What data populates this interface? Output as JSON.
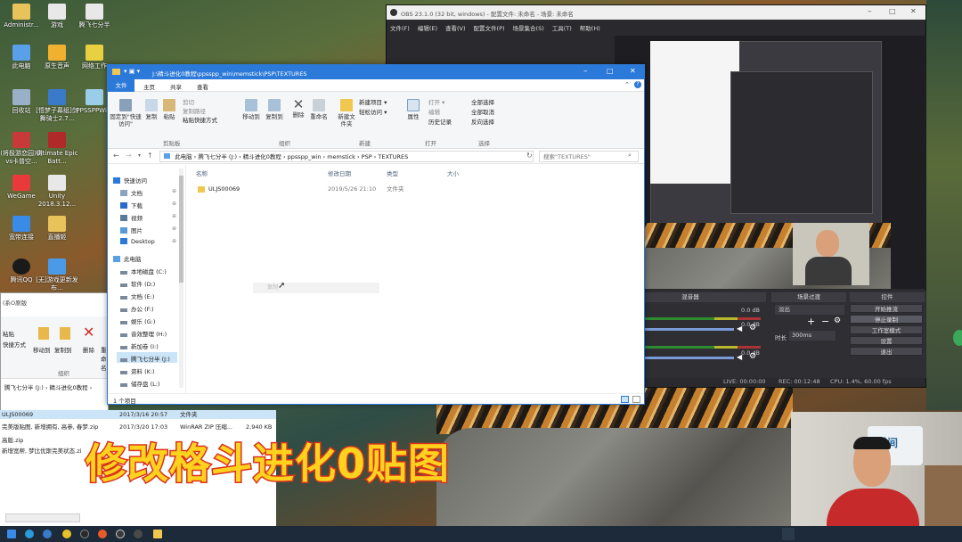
{
  "desktop": {
    "icons": [
      {
        "label": "Administr...",
        "color": "#e8c25a"
      },
      {
        "label": "游戏",
        "color": "#e8e8e8"
      },
      {
        "label": "腾飞七分半",
        "color": "#e8e8e8"
      },
      {
        "label": "此电脑",
        "color": "#5aa0e8"
      },
      {
        "label": "原生音声",
        "color": "#f0b030"
      },
      {
        "label": "网络工作",
        "color": "#e8d040"
      },
      {
        "label": "回收站",
        "color": "#9ab0c8"
      },
      {
        "label": "[悟梦子幕组]剑舞骑士2.7...",
        "color": "#3a7ac8"
      },
      {
        "label": "PPSSPPWi...",
        "color": "#9acde8"
      },
      {
        "label": "(将极游恋园)赛vs卡普空...",
        "color": "#c83a3a"
      },
      {
        "label": "Ultimate Epic Batt...",
        "color": "#b02a2a"
      },
      {
        "label": "WeGame",
        "color": "#e83a3a"
      },
      {
        "label": "Unity 2018.3.12...",
        "color": "#e8e8e8"
      },
      {
        "label": "宽带连接",
        "color": "#3a8ae8"
      },
      {
        "label": "直播姬",
        "color": "#e8c25a"
      },
      {
        "label": "腾讯QQ",
        "color": "#1a1a1a"
      },
      {
        "label": "[无]游戏更新发布…",
        "color": "#4a9ae8"
      }
    ]
  },
  "bg_explorer": {
    "title": "(系O原版",
    "ribbon": [
      "粘贴",
      "快捷方式",
      "移动到",
      "复制到",
      "删除",
      "重命名",
      "组织"
    ],
    "path": [
      "腾飞七分半 (J:)",
      "精斗进化0教程"
    ],
    "files": [
      {
        "name": "ULJS00069",
        "date": "2017/3/16 20:57",
        "type": "文件夹",
        "size": ""
      },
      {
        "name": "完美版贴图, 新增拥有, 高参, 春梦.zip",
        "date": "2017/3/20 17:03",
        "type": "WinRAR ZIP 压缩...",
        "size": "2,940 KB"
      },
      {
        "name": "高版.zip",
        "date": "",
        "type": "",
        "size": ""
      },
      {
        "name": "新增宽帮, 梦比优斯完美状态.zi",
        "date": "",
        "type": "",
        "size": ""
      }
    ]
  },
  "explorer": {
    "title": "J:\\精斗进化0教程\\ppsspp_win\\memstick\\PSP\\TEXTURES",
    "tabs": [
      "文件",
      "主页",
      "共享",
      "查看"
    ],
    "ribbon": {
      "clipboard": {
        "group": "剪贴板",
        "pin": "固定到\"快速访问\"",
        "copy": "复制",
        "paste": "粘贴",
        "cut": "剪切",
        "copy_path": "复制路径",
        "paste_shortcut": "粘贴快捷方式"
      },
      "organize": {
        "group": "组织",
        "move_to": "移动到",
        "copy_to": "复制到",
        "delete": "删除",
        "rename": "重命名"
      },
      "new": {
        "group": "新建",
        "new_folder": "新建文件夹",
        "new_item": "新建项目 ▾",
        "easy_access": "轻松访问 ▾"
      },
      "open": {
        "group": "打开",
        "properties": "属性",
        "open": "打开 ▾",
        "edit": "编辑",
        "history": "历史记录"
      },
      "select": {
        "group": "选择",
        "select_all": "全部选择",
        "select_none": "全部取消",
        "invert": "反向选择"
      }
    },
    "address": [
      "此电脑",
      "腾飞七分半 (J:)",
      "精斗进化0教程",
      "ppsspp_win",
      "memstick",
      "PSP",
      "TEXTURES"
    ],
    "search_placeholder": "搜索\"TEXTURES\"",
    "nav": [
      {
        "label": "快速访问",
        "pin": false,
        "kind": "star"
      },
      {
        "label": "文档",
        "pin": true,
        "kind": "doc"
      },
      {
        "label": "下载",
        "pin": true,
        "kind": "down"
      },
      {
        "label": "视频",
        "pin": true,
        "kind": "video"
      },
      {
        "label": "图片",
        "pin": true,
        "kind": "pic"
      },
      {
        "label": "Desktop",
        "pin": true,
        "kind": "desk"
      },
      {
        "label": "此电脑",
        "pin": false,
        "kind": "pc"
      },
      {
        "label": "本地磁盘 (C:)",
        "pin": false,
        "kind": "drive"
      },
      {
        "label": "软件 (D:)",
        "pin": false,
        "kind": "drive"
      },
      {
        "label": "文档 (E:)",
        "pin": false,
        "kind": "drive"
      },
      {
        "label": "办公 (F:)",
        "pin": false,
        "kind": "drive"
      },
      {
        "label": "娱乐 (G:)",
        "pin": false,
        "kind": "drive"
      },
      {
        "label": "音效整理 (H:)",
        "pin": false,
        "kind": "drive"
      },
      {
        "label": "新加卷 (I:)",
        "pin": false,
        "kind": "drive"
      },
      {
        "label": "腾飞七分半 (J:)",
        "pin": false,
        "kind": "drive"
      },
      {
        "label": "资料 (K:)",
        "pin": false,
        "kind": "drive"
      },
      {
        "label": "储存盘 (L:)",
        "pin": false,
        "kind": "drive"
      }
    ],
    "columns": [
      "名称",
      "修改日期",
      "类型",
      "大小"
    ],
    "files": [
      {
        "name": "ULJS00069",
        "date": "2019/5/26 21:10",
        "type": "文件夹",
        "size": ""
      }
    ],
    "ghost_label": "复制",
    "status": "1 个项目"
  },
  "obs": {
    "title": "OBS 23.1.0 (32 bit, windows) - 配置文件: 未命名 - 场景: 未命名",
    "menu": [
      "文件(F)",
      "编辑(E)",
      "查看(V)",
      "配置文件(P)",
      "场景集合(S)",
      "工具(T)",
      "帮助(H)"
    ],
    "mixer_title": "混音器",
    "mixer_db": [
      "0.0 dB",
      "0.0 dB",
      "0.0 dB"
    ],
    "transition_title": "场景过渡",
    "transition_value": "淡出",
    "duration_label": "时长",
    "duration_value": "300ms",
    "controls_title": "控件",
    "controls": [
      "开始推流",
      "停止录制",
      "工作室模式",
      "设置",
      "退出"
    ],
    "status": {
      "live": "LIVE: 00:00:00",
      "rec": "REC: 00:12:48",
      "cpu": "CPU: 1.4%, 60.00 fps"
    }
  },
  "overlay": {
    "caption": "修改格斗进化0贴图",
    "watermark": "时间"
  },
  "taskbar": {
    "icons": [
      "start-icon",
      "qq-icon",
      "edge-icon",
      "chrome-icon",
      "music-icon",
      "firefox-icon",
      "obs-icon",
      "folder-icon",
      "app-icon",
      "explorer-icon"
    ]
  }
}
